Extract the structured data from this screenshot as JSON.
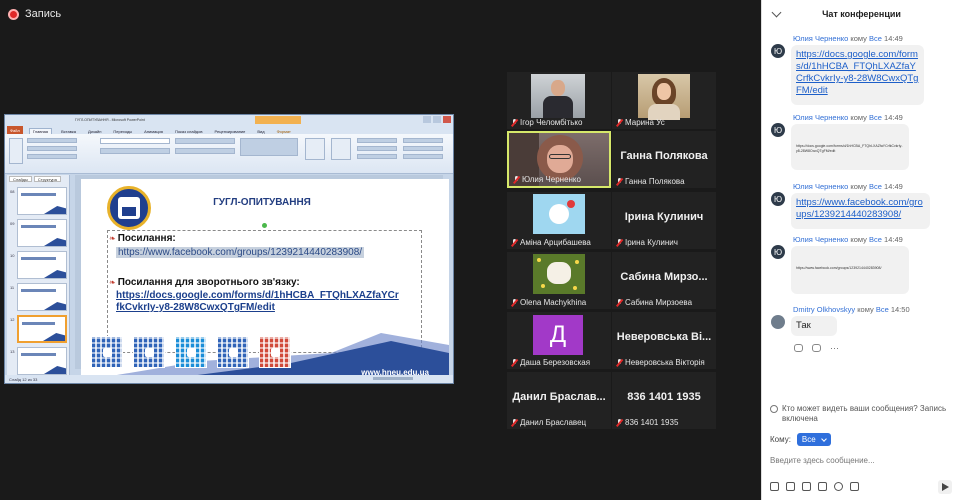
{
  "recording": {
    "label": "Запись"
  },
  "shared_screen": {
    "window_title": "ГУГЛ-ОПИТУВАННЯ - Microsoft PowerPoint",
    "ribbon_tabs": [
      "Файл",
      "Главная",
      "Вставка",
      "Дизайн",
      "Переходы",
      "Анимация",
      "Показ слайдов",
      "Рецензирование",
      "Вид",
      "Формат"
    ],
    "side_tabs": [
      "Слайды",
      "Структура"
    ],
    "slide_numbers": [
      "08",
      "09",
      "10",
      "11",
      "12",
      "13",
      "14"
    ],
    "status": "Слайд 12 из 33",
    "slide": {
      "title": "ГУГЛ-ОПИТУВАННЯ",
      "heading1": "Посилання:",
      "link1": "https://www.facebook.com/groups/1239214440283908/",
      "heading2": "Посилання для зворотнього зв'язку:",
      "link2": "https://docs.google.com/forms/d/1hHCBA_FTQhLXAZfaYCrfkCvkrIy-y8-28W8CwxQTgFM/edit",
      "website": "www.hneu.edu.ua",
      "qr_colors": [
        "#2f63b8",
        "#2f63b8",
        "#1a8ed8",
        "#2f63b8",
        "#d14a3a"
      ]
    }
  },
  "participants": [
    {
      "name": "Ігор Челомбітько",
      "display": "photo",
      "muted": true
    },
    {
      "name": "Марина Ус",
      "display": "photo",
      "muted": true
    },
    {
      "name": "Юлия Черненко",
      "display": "camera",
      "muted": true,
      "active_speaker": true
    },
    {
      "name": "Ганна Полякова",
      "display": "name",
      "big_label": "Ганна Полякова",
      "muted": true
    },
    {
      "name": "Аміна Арцибашева",
      "display": "avatar",
      "muted": true
    },
    {
      "name": "Ірина Кулинич",
      "display": "name",
      "big_label": "Ірина Кулинич",
      "muted": true
    },
    {
      "name": "Olena Machykhina",
      "display": "avatar",
      "muted": true
    },
    {
      "name": "Сабина Мирзоева",
      "display": "name",
      "big_label": "Сабина Мирзо...",
      "muted": true
    },
    {
      "name": "Даша Березовская",
      "display": "letter",
      "letter": "Д",
      "muted": true
    },
    {
      "name": "Неверовська Вікторія",
      "display": "name",
      "big_label": "Неверовська Ві...",
      "muted": true
    },
    {
      "name": "Данил Браславец",
      "display": "name",
      "big_label": "Данил Браслав...",
      "muted": true
    },
    {
      "name": "836 1401 1935",
      "display": "name",
      "big_label": "836 1401 1935",
      "muted": true
    }
  ],
  "chat": {
    "title": "Чат конференции",
    "messages": [
      {
        "avatar": "Ю",
        "sender": "Юлия Черненко",
        "to_word": "кому",
        "recipient": "Все",
        "time": "14:49",
        "text": "https://docs.google.com/forms/d/1hHCBA_FTQhLXAZfaYCrfkCvkrIy-y8-28W8CwxQTgFM/edit"
      },
      {
        "avatar": "Ю",
        "sender": "Юлия Черненко",
        "to_word": "кому",
        "recipient": "Все",
        "time": "14:49",
        "text": "https://docs.google.com/forms/d/1hHCBA_FTQhLXAZfaYCrfkCvkrIy-y8-28W8CwxQTgFM/edit"
      },
      {
        "avatar": "Ю",
        "sender": "Юлия Черненко",
        "to_word": "кому",
        "recipient": "Все",
        "time": "14:49",
        "text": "https://www.facebook.com/groups/1239214440283908/"
      },
      {
        "avatar": "Ю",
        "sender": "Юлия Черненко",
        "to_word": "кому",
        "recipient": "Все",
        "time": "14:49",
        "text": "https://www.facebook.com/groups/1239214440283908/"
      },
      {
        "avatar": "",
        "sender": "Dmitry Olkhovskyy",
        "to_word": "кому",
        "recipient": "Все",
        "time": "14:50",
        "text": "Так"
      }
    ],
    "privacy_notice": "Кто может видеть ваши сообщения? Запись включена",
    "to_label": "Кому:",
    "to_value": "Все",
    "input_placeholder": "Введите здесь сообщение..."
  }
}
